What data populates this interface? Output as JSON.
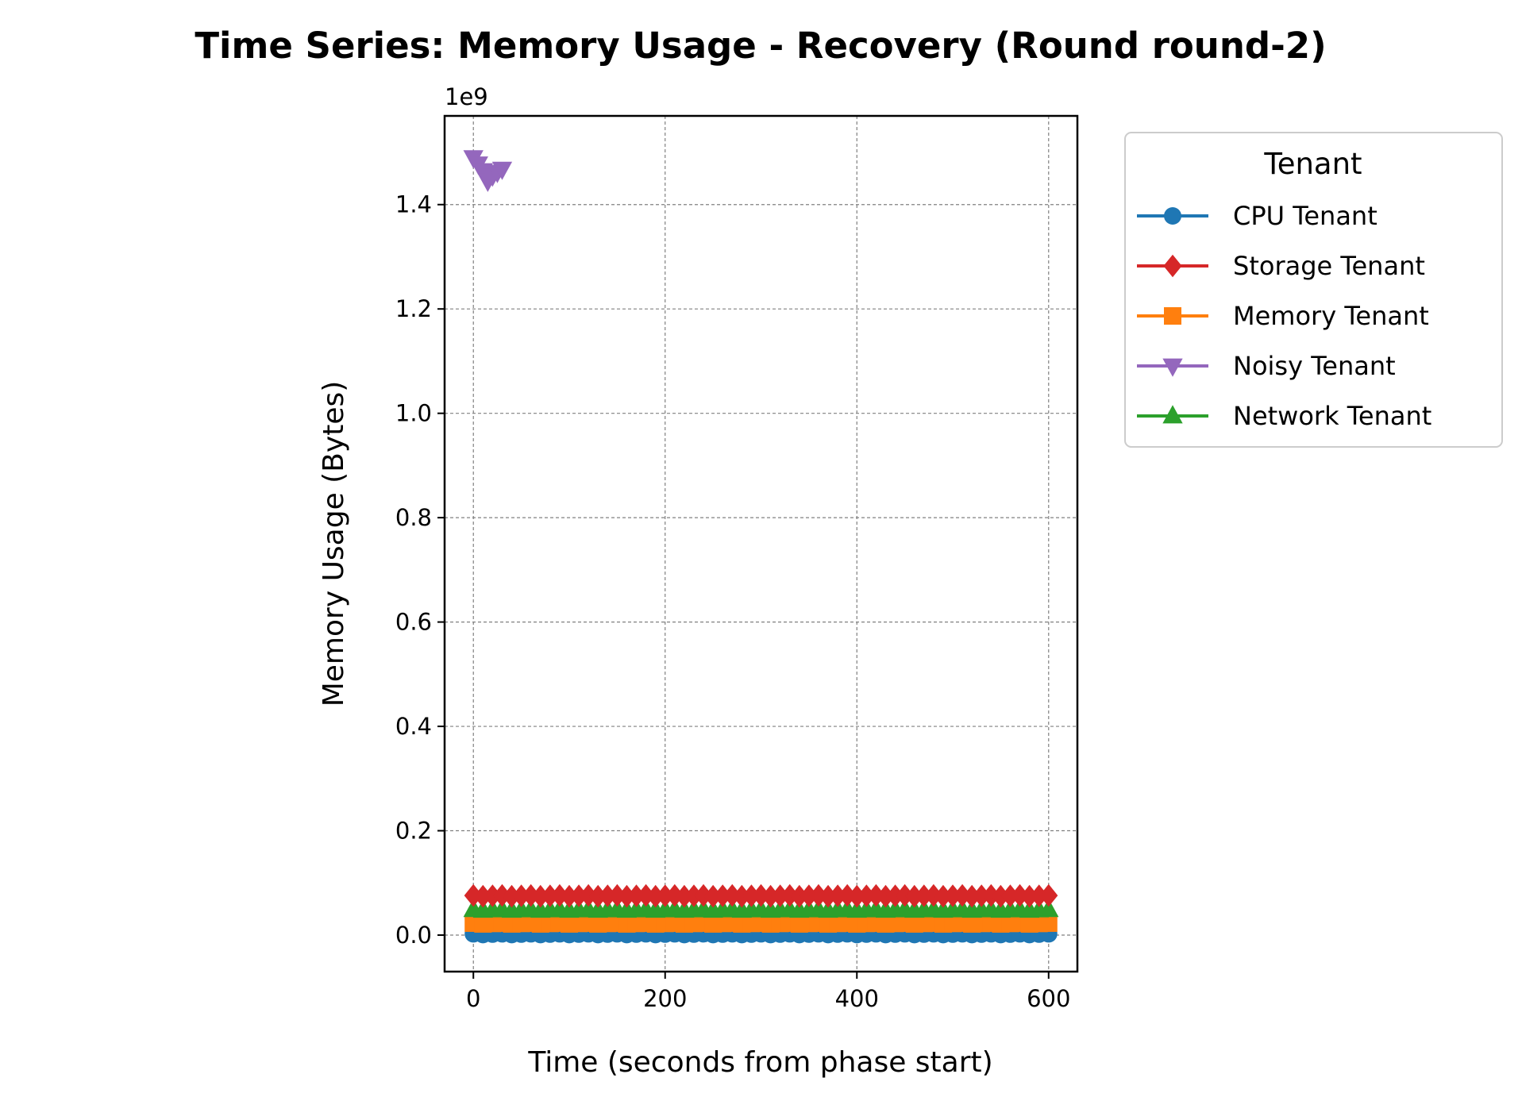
{
  "chart_data": {
    "type": "line",
    "title": "Time Series: Memory Usage - Recovery (Round round-2)",
    "xlabel": "Time (seconds from phase start)",
    "ylabel": "Memory Usage (Bytes)",
    "y_offset_label": "1e9",
    "xlim": [
      -30,
      630
    ],
    "ylim": [
      -70000000,
      1570000000
    ],
    "x_ticks": [
      0,
      200,
      400,
      600
    ],
    "x_tick_labels": [
      "0",
      "200",
      "400",
      "600"
    ],
    "y_ticks": [
      0,
      200000000,
      400000000,
      600000000,
      800000000,
      1000000000,
      1200000000,
      1400000000
    ],
    "y_tick_labels": [
      "0.0",
      "0.2",
      "0.4",
      "0.6",
      "0.8",
      "1.0",
      "1.2",
      "1.4"
    ],
    "grid": true,
    "legend": {
      "title": "Tenant",
      "placement": "outside-right-top"
    },
    "series": [
      {
        "name": "CPU Tenant",
        "color": "#1f77b4",
        "marker": "circle",
        "x_start": 0,
        "x_end": 600,
        "x_step": 10,
        "y_base": 1500000
      },
      {
        "name": "Storage Tenant",
        "color": "#d62728",
        "marker": "diamond",
        "x_start": 0,
        "x_end": 600,
        "x_step": 10,
        "y_base": 75000000
      },
      {
        "name": "Memory Tenant",
        "color": "#ff7f0e",
        "marker": "square",
        "x_start": 0,
        "x_end": 600,
        "x_step": 10,
        "y_base": 22000000
      },
      {
        "name": "Noisy Tenant",
        "color": "#9467bd",
        "marker": "triangle-down",
        "x": [
          0,
          5,
          10,
          15,
          20,
          25,
          30
        ],
        "y": [
          1490000000,
          1478000000,
          1465000000,
          1445000000,
          1455000000,
          1462000000,
          1468000000
        ]
      },
      {
        "name": "Network Tenant",
        "color": "#2ca02c",
        "marker": "triangle-up",
        "x_start": 0,
        "x_end": 600,
        "x_step": 10,
        "y_base": 48000000
      }
    ]
  }
}
